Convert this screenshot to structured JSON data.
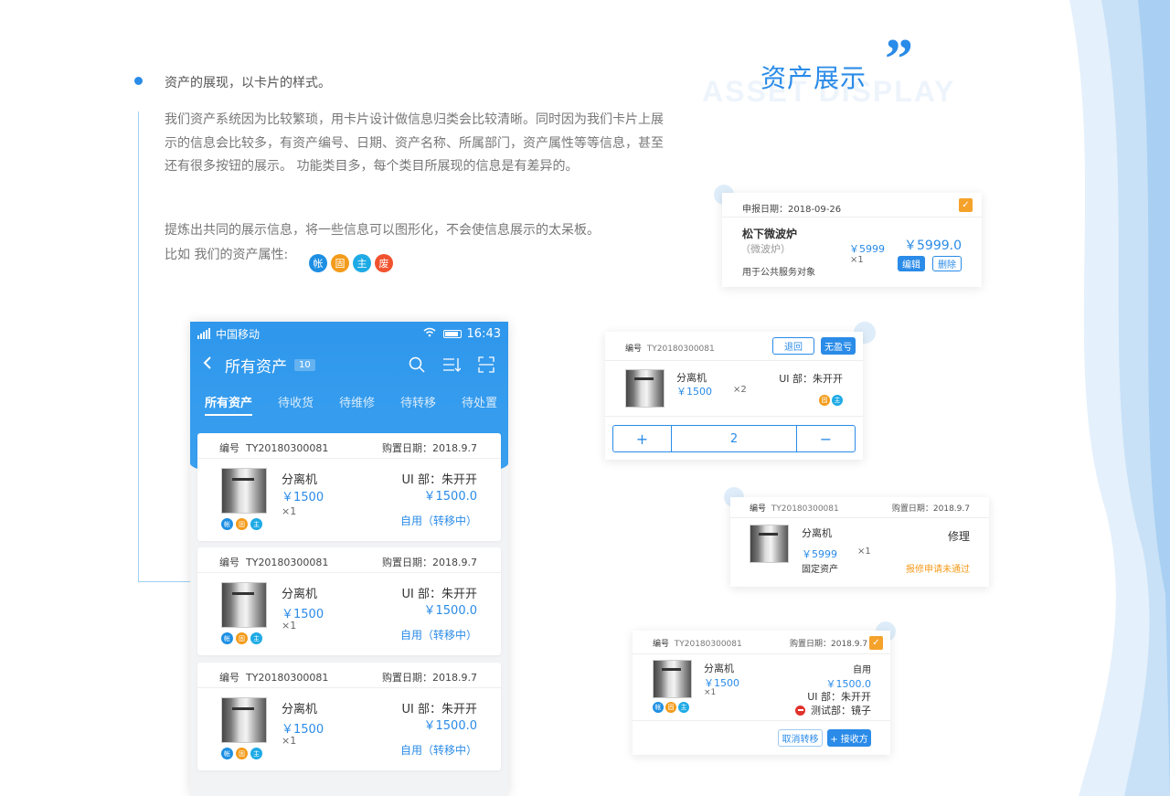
{
  "heading": {
    "title": "资产展示",
    "subtitle_en": "ASSET DISPLAY",
    "quote": "”"
  },
  "intro": {
    "lead": "资产的展现，以卡片的样式。",
    "para1": "我们资产系统因为比较繁琐，用卡片设计做信息归类会比较清晰。同时因为我们卡片上展示的信息会比较多，有资产编号、日期、资产名称、所属部门，资产属性等等信息，甚至还有很多按钮的展示。 功能类目多，每个类目所展现的信息是有差异的。",
    "para2": "提炼出共同的展示信息，将一些信息可以图形化，不会使信息展示的太呆板。",
    "para3": "比如 我们的资产属性:",
    "tags": [
      "帐",
      "固",
      "主",
      "废"
    ]
  },
  "phone": {
    "status": {
      "carrier": "中国移动",
      "time": "16:43"
    },
    "title": "所有资产",
    "count": "10",
    "tabs": [
      "所有资产",
      "待收货",
      "待维修",
      "待转移",
      "待处置"
    ],
    "cards": [
      {
        "no_label": "编号",
        "no": "TY20180300081",
        "date": "购置日期：2018.9.7",
        "name": "分离机",
        "price": "￥1500",
        "qty": "×1",
        "dept": "UI 部：朱开开",
        "price2": "￥1500.0",
        "status": "自用（转移中）",
        "tags": [
          "帐",
          "固",
          "主"
        ]
      },
      {
        "no_label": "编号",
        "no": "TY20180300081",
        "date": "购置日期：2018.9.7",
        "name": "分离机",
        "price": "￥1500",
        "qty": "×1",
        "dept": "UI 部：朱开开",
        "price2": "￥1500.0",
        "status": "自用（转移中）",
        "tags": [
          "帐",
          "固",
          "主"
        ]
      },
      {
        "no_label": "编号",
        "no": "TY20180300081",
        "date": "购置日期：2018.9.7",
        "name": "分离机",
        "price": "￥1500",
        "qty": "×1",
        "dept": "UI 部：朱开开",
        "price2": "￥1500.0",
        "status": "自用（转移中）",
        "tags": [
          "帐",
          "固",
          "主"
        ]
      }
    ]
  },
  "card_a": {
    "date": "申报日期：2018-09-26",
    "name": "松下微波炉",
    "sub": "（微波炉）",
    "purpose": "用于公共服务对象",
    "price": "￥5999",
    "qty": "×1",
    "total": "￥5999.0",
    "edit": "编辑",
    "delete": "删除",
    "check": "✓"
  },
  "card_b": {
    "no_label": "编号",
    "no": "TY20180300081",
    "back": "退回",
    "nodiff": "无盈亏",
    "name": "分离机",
    "price": "￥1500",
    "qty": "×2",
    "dept": "UI 部：朱开开",
    "tags": [
      "固",
      "主"
    ],
    "plus": "+",
    "value": "2",
    "minus": "−"
  },
  "card_c": {
    "no_label": "编号",
    "no": "TY20180300081",
    "date": "购置日期：2018.9.7",
    "name": "分离机",
    "type": "修理",
    "price": "￥5999",
    "qty": "×1",
    "category": "固定资产",
    "status": "报修申请未通过"
  },
  "card_d": {
    "no_label": "编号",
    "no": "TY20180300081",
    "date": "购置日期：2018.9.7",
    "name": "分离机",
    "price": "￥1500",
    "qty": "×1",
    "use": "自用",
    "total": "￥1500.0",
    "dept": "UI 部：朱开开",
    "test": "测试部：镜子",
    "tags": [
      "帐",
      "固",
      "主"
    ],
    "cancel": "取消转移",
    "receiver": "+ 接收方",
    "check": "✓"
  }
}
